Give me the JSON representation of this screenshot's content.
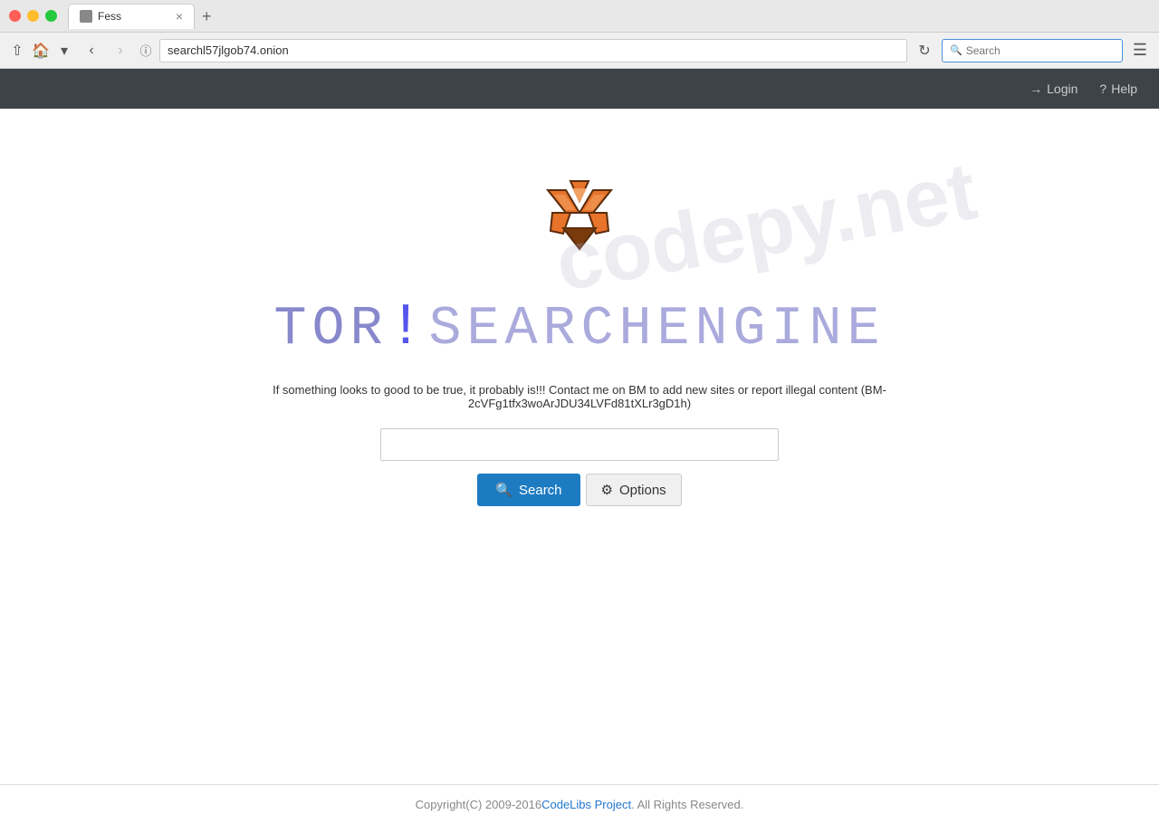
{
  "browser": {
    "tab_title": "Fess",
    "tab_new_label": "+",
    "tab_close_label": "×",
    "address_bar_value": "searchl57jlgob74.onion",
    "search_placeholder": "Search",
    "menu_icon": "☰",
    "back_btn": "‹",
    "forward_btn": "›",
    "reload_btn": "↻",
    "info_icon": "ⓘ"
  },
  "site_navbar": {
    "login_label": "Login",
    "help_label": "Help"
  },
  "main": {
    "title_tor": "TOR",
    "title_exclaim": "!",
    "title_search": " SEARCHENGINE",
    "disclaimer": "If something looks to good to be true, it probably is!!! Contact me on BM to add new sites or report illegal content (BM-2cVFg1tfx3woArJDU34LVFd81tXLr3gD1h)",
    "search_button": "Search",
    "options_button": "Options",
    "search_icon": "🔍",
    "options_icon": "⚙"
  },
  "footer": {
    "copyright_text": "Copyright(C) 2009-2016 ",
    "link_text": "CodeLibs Project",
    "rights_text": ". All Rights Reserved."
  },
  "watermark": {
    "text": "codepy.net"
  },
  "colors": {
    "accent_blue": "#1d7bc2",
    "title_color": "#8888cc",
    "exclaim_color": "#5555ee",
    "navbar_bg": "#3d4347",
    "footer_link": "#2277cc"
  }
}
